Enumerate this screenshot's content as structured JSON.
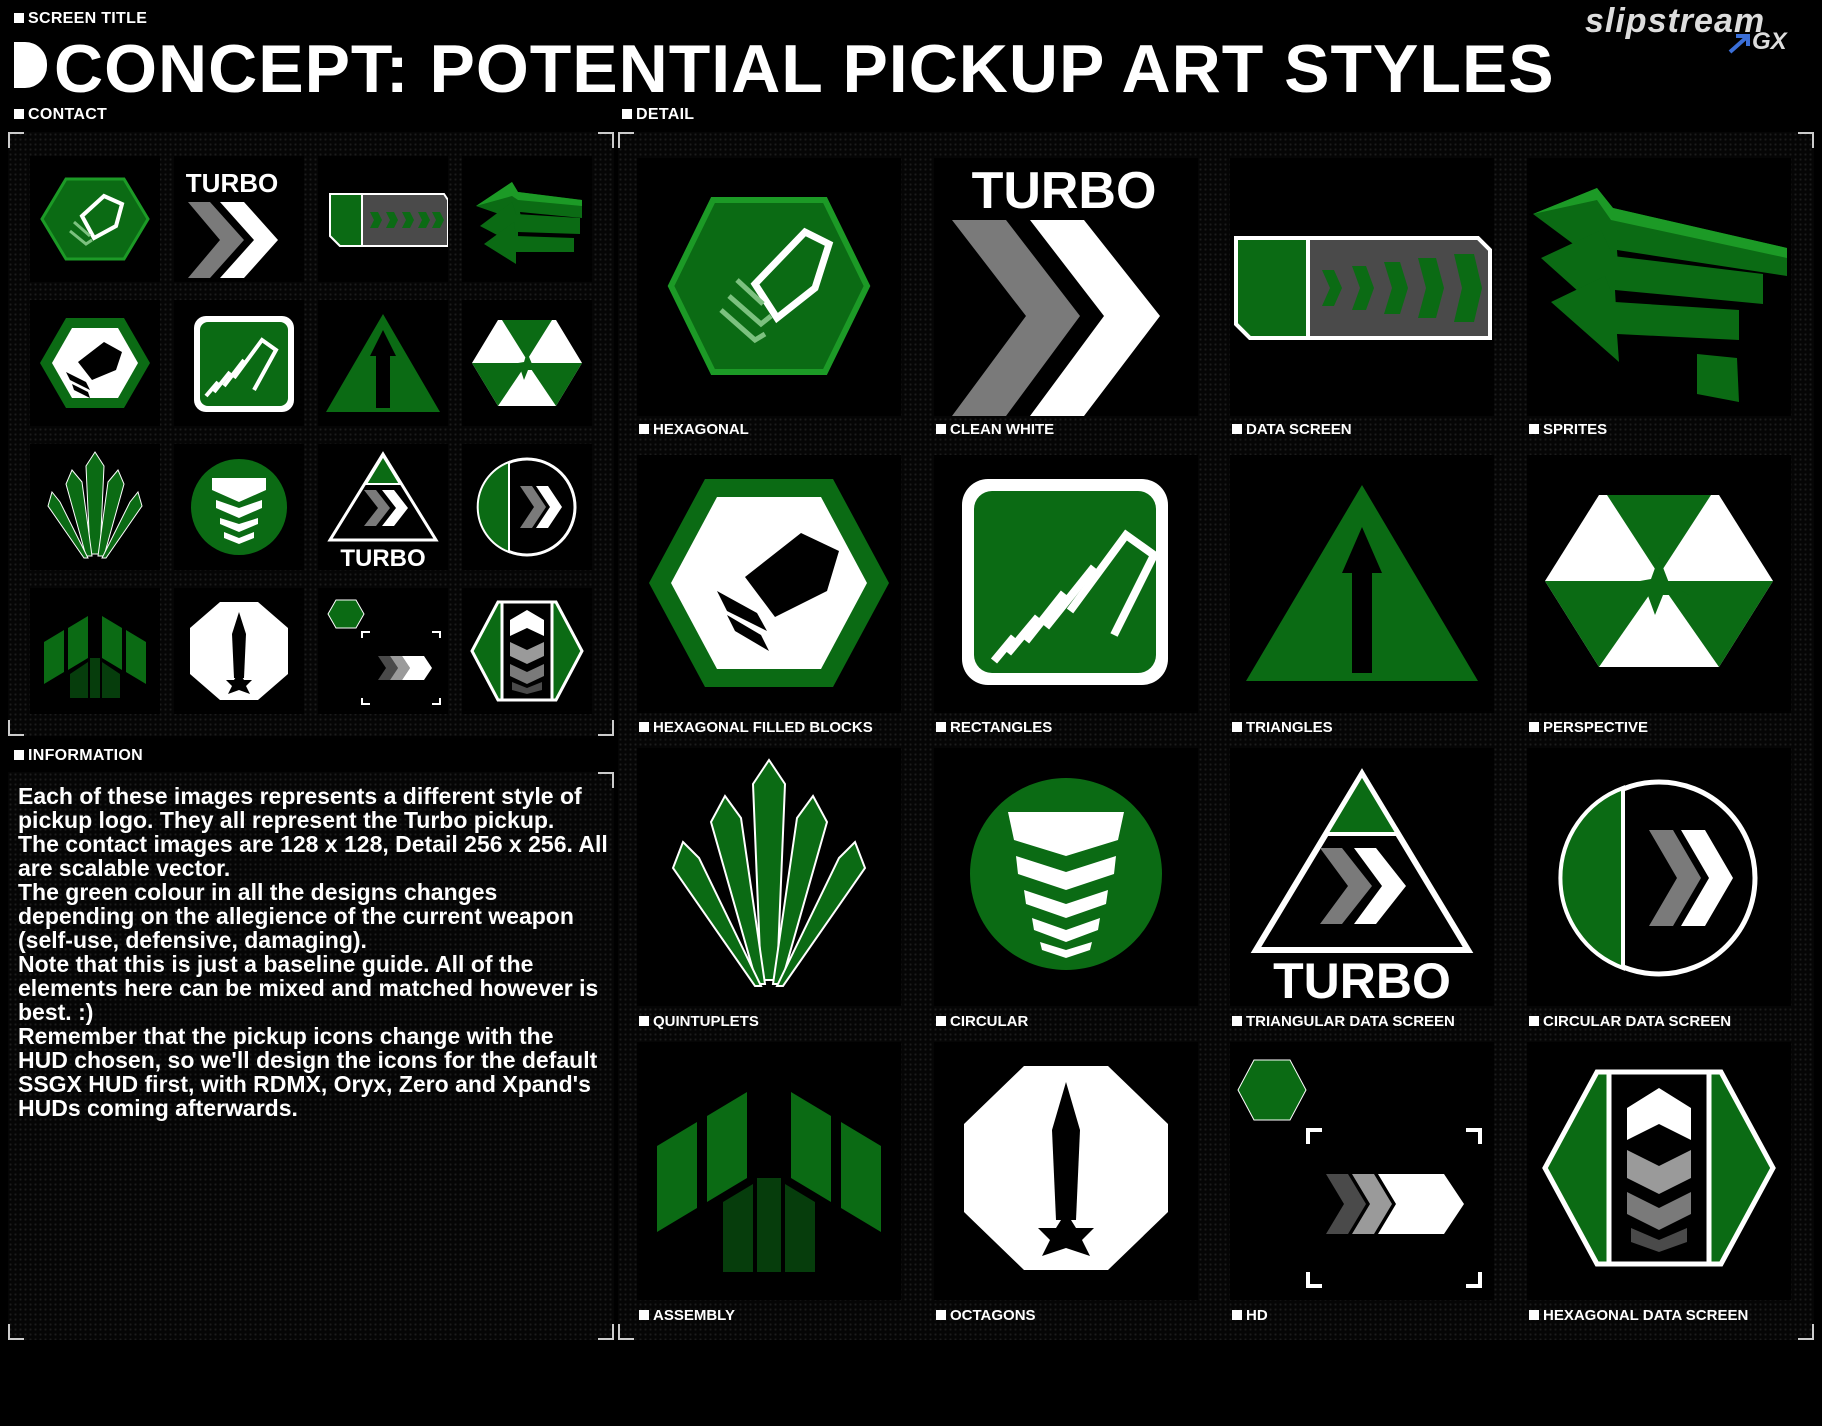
{
  "header": {
    "screen_title_label": "SCREEN TITLE",
    "title": "CONCEPT: POTENTIAL PICKUP ART STYLES",
    "logo_top": "slipstream",
    "logo_bottom": "GX"
  },
  "sections": {
    "contact": "CONTACT",
    "detail": "DETAIL",
    "information": "INFORMATION"
  },
  "contact_labels": {
    "turbo_1": "TURBO",
    "turbo_2": "TURBO"
  },
  "detail_tiles": [
    {
      "label": "HEXAGONAL",
      "icon": "hexagon-pickup-icon"
    },
    {
      "label": "CLEAN WHITE",
      "icon": "chevron-turbo-icon",
      "text": "TURBO"
    },
    {
      "label": "DATA SCREEN",
      "icon": "data-screen-icon"
    },
    {
      "label": "SPRITES",
      "icon": "sprite-arrows-icon"
    },
    {
      "label": "HEXAGONAL FILLED BLOCKS",
      "icon": "hexagon-blocks-icon"
    },
    {
      "label": "RECTANGLES",
      "icon": "rounded-rect-icon"
    },
    {
      "label": "TRIANGLES",
      "icon": "triangle-arrow-icon"
    },
    {
      "label": "PERSPECTIVE",
      "icon": "perspective-hex-icon"
    },
    {
      "label": "QUINTUPLETS",
      "icon": "quintuplet-fan-icon"
    },
    {
      "label": "CIRCULAR",
      "icon": "circular-stack-icon"
    },
    {
      "label": "TRIANGULAR DATA SCREEN",
      "icon": "triangular-data-icon",
      "text": "TURBO"
    },
    {
      "label": "CIRCULAR DATA SCREEN",
      "icon": "circular-data-icon"
    },
    {
      "label": "ASSEMBLY",
      "icon": "assembly-chevron-icon"
    },
    {
      "label": "OCTAGONS",
      "icon": "octagon-arrow-icon"
    },
    {
      "label": "HD",
      "icon": "hd-bracket-icon"
    },
    {
      "label": "HEXAGONAL DATA SCREEN",
      "icon": "hexagonal-data-icon"
    }
  ],
  "information_paragraphs": [
    "Each of these images represents a different style of pickup logo. They all represent the Turbo pickup.",
    "The contact images are 128 x 128, Detail 256 x 256. All are scalable vector.",
    "The green colour in all the designs changes depending on the allegience of the current weapon (self-use, defensive, damaging).",
    "Note that this is just a baseline guide. All of the elements here can be mixed and matched however is best. :)",
    "Remember that the pickup icons change with the HUD chosen, so we'll design the icons for the default SSGX HUD first, with RDMX, Oryx, Zero and Xpand's HUDs coming afterwards."
  ],
  "colors": {
    "background": "#000000",
    "accent_green": "#0b6b14",
    "grey": "#7a7a7a",
    "white": "#ffffff"
  }
}
